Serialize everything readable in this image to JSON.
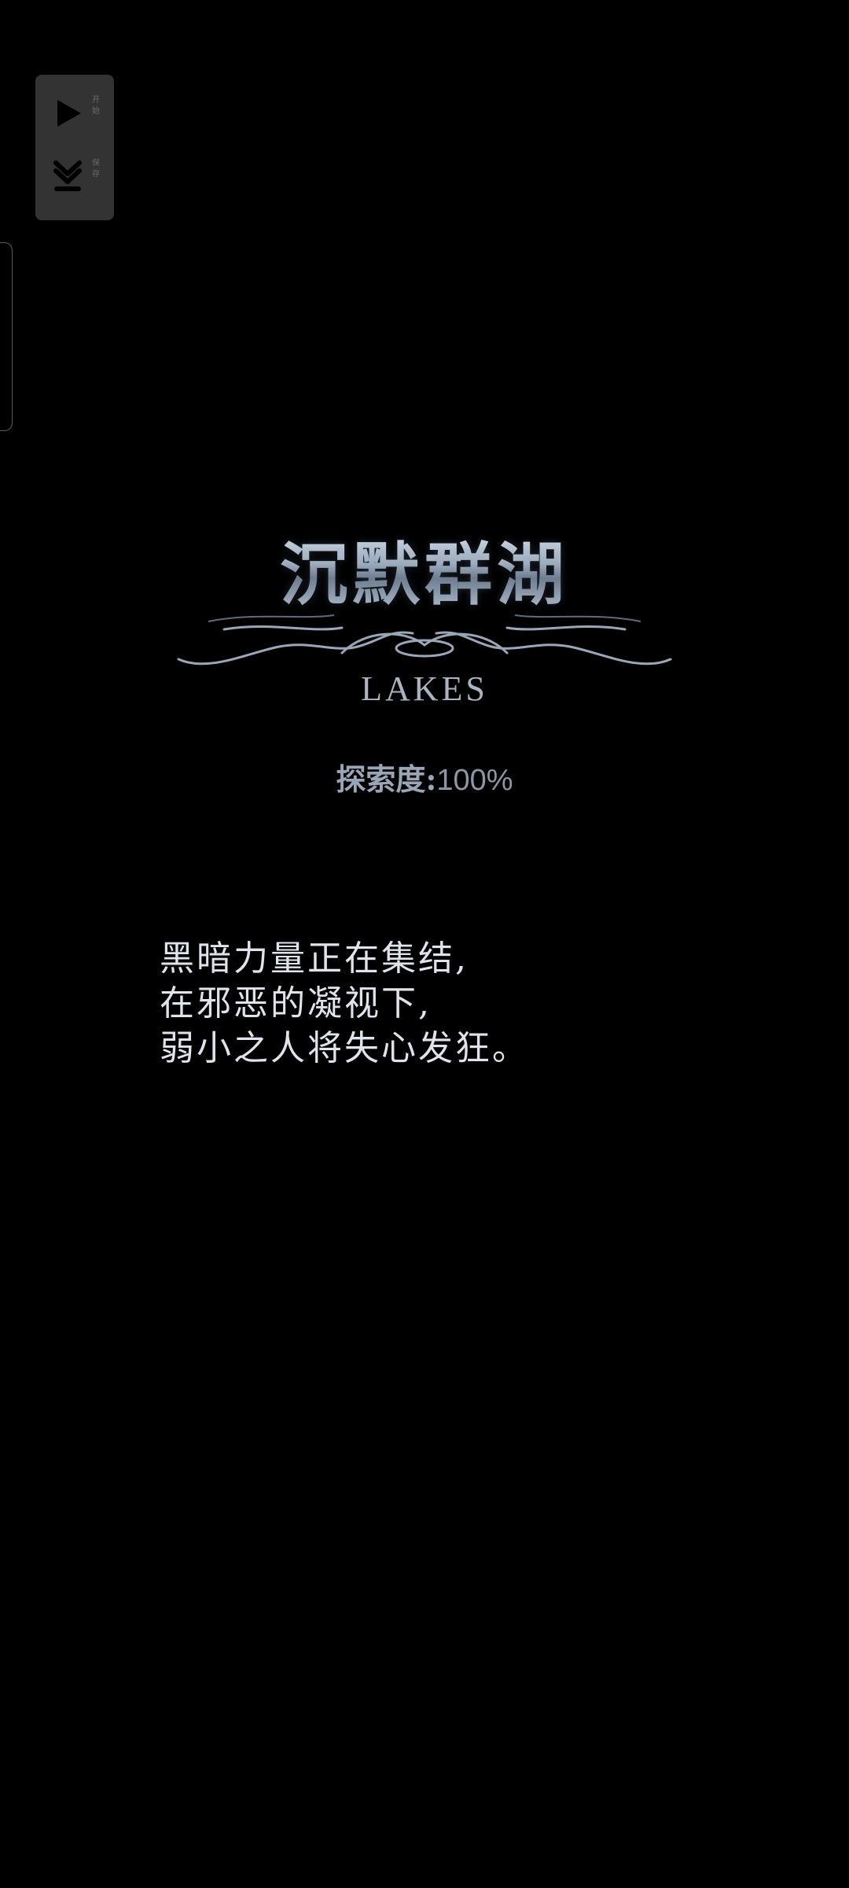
{
  "floating_panel": {
    "start_label": "开始",
    "record_label": "保存",
    "start_icon": "play-icon",
    "record_icon": "download-icon"
  },
  "area": {
    "title_cn": "沉默群湖",
    "title_en": "LAKES"
  },
  "exploration": {
    "label": "探索度:",
    "value": "100%"
  },
  "description": {
    "lines": [
      "黑暗力量正在集结,",
      "在邪恶的凝视下,",
      "弱小之人将失心发狂。"
    ]
  },
  "colors": {
    "background": "#000000",
    "panel": "#333333",
    "text": "#dfe3ea",
    "title_metal": "#b8c2cf"
  }
}
